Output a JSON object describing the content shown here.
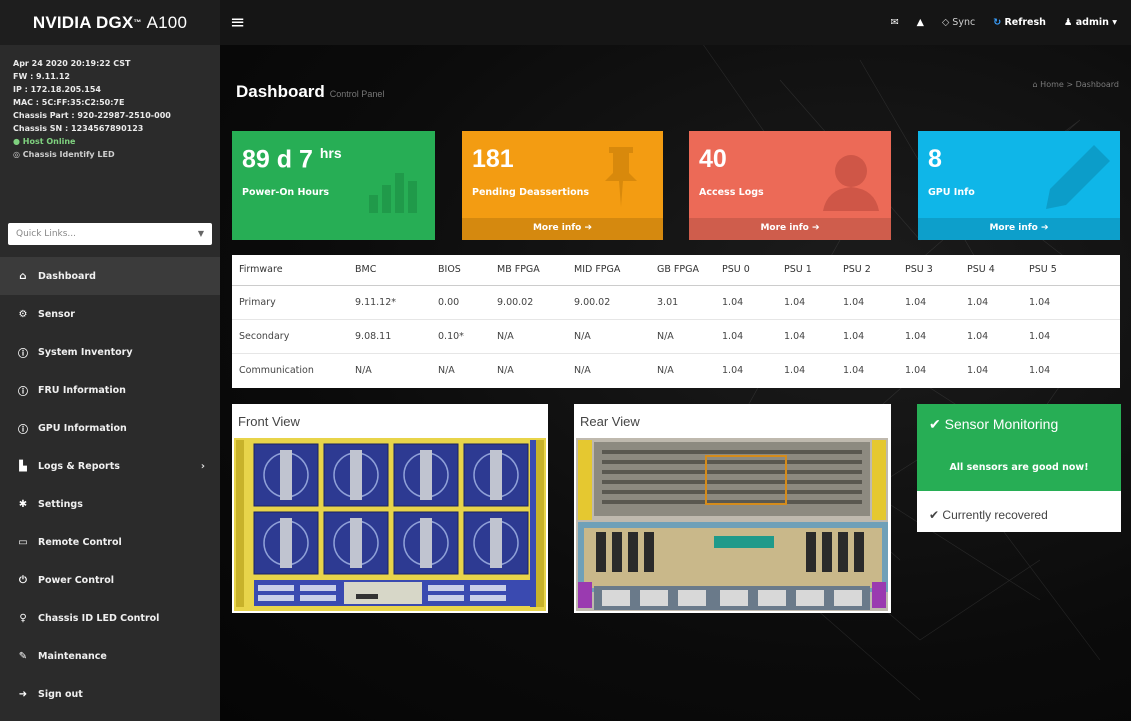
{
  "brand": {
    "name": "NVIDIA DGX",
    "tm": "™",
    "model": "A100"
  },
  "sysinfo": {
    "datetime": "Apr 24 2020 20:19:22 CST",
    "fw": "FW : 9.11.12",
    "ip": "IP : 172.18.205.154",
    "mac": "MAC : 5C:FF:35:C2:50:7E",
    "chassis_part": "Chassis Part : 920-22987-2510-000",
    "chassis_sn": "Chassis SN : 1234567890123",
    "host_status": "Host Online",
    "identify_led": "Chassis Identify LED"
  },
  "quicklinks": {
    "placeholder": "Quick Links..."
  },
  "nav": [
    {
      "label": "Dashboard",
      "icon": "home-icon"
    },
    {
      "label": "Sensor",
      "icon": "sensor-icon"
    },
    {
      "label": "System Inventory",
      "icon": "info-icon"
    },
    {
      "label": "FRU Information",
      "icon": "info-icon"
    },
    {
      "label": "GPU Information",
      "icon": "info-icon"
    },
    {
      "label": "Logs & Reports",
      "icon": "bar-chart-icon"
    },
    {
      "label": "Settings",
      "icon": "gear-icon"
    },
    {
      "label": "Remote Control",
      "icon": "monitor-icon"
    },
    {
      "label": "Power Control",
      "icon": "power-icon"
    },
    {
      "label": "Chassis ID LED Control",
      "icon": "bulb-icon"
    },
    {
      "label": "Maintenance",
      "icon": "wrench-icon"
    },
    {
      "label": "Sign out",
      "icon": "signout-icon"
    }
  ],
  "topbar": {
    "sync": "Sync",
    "refresh": "Refresh",
    "user": "admin"
  },
  "page": {
    "title": "Dashboard",
    "subtitle": "Control Panel",
    "crumb_home": "Home",
    "crumb_current": "Dashboard"
  },
  "tiles": [
    {
      "value": "89 d 7",
      "unit": "hrs",
      "label": "Power-On Hours",
      "more": ""
    },
    {
      "value": "181",
      "unit": "",
      "label": "Pending Deassertions",
      "more": "More info"
    },
    {
      "value": "40",
      "unit": "",
      "label": "Access Logs",
      "more": "More info"
    },
    {
      "value": "8",
      "unit": "",
      "label": "GPU Info",
      "more": "More info"
    }
  ],
  "firmware": {
    "headers": [
      "Firmware",
      "BMC",
      "BIOS",
      "MB FPGA",
      "MID FPGA",
      "GB FPGA",
      "PSU 0",
      "PSU 1",
      "PSU 2",
      "PSU 3",
      "PSU 4",
      "PSU 5"
    ],
    "rows": [
      [
        "Primary",
        "9.11.12*",
        "0.00",
        "9.00.02",
        "9.00.02",
        "3.01",
        "1.04",
        "1.04",
        "1.04",
        "1.04",
        "1.04",
        "1.04"
      ],
      [
        "Secondary",
        "9.08.11",
        "0.10*",
        "N/A",
        "N/A",
        "N/A",
        "1.04",
        "1.04",
        "1.04",
        "1.04",
        "1.04",
        "1.04"
      ],
      [
        "Communication",
        "N/A",
        "N/A",
        "N/A",
        "N/A",
        "N/A",
        "1.04",
        "1.04",
        "1.04",
        "1.04",
        "1.04",
        "1.04"
      ]
    ]
  },
  "views": {
    "front": "Front View",
    "rear": "Rear View"
  },
  "sensor": {
    "title": "Sensor Monitoring",
    "message": "All sensors are good now!",
    "status": "Currently recovered"
  }
}
